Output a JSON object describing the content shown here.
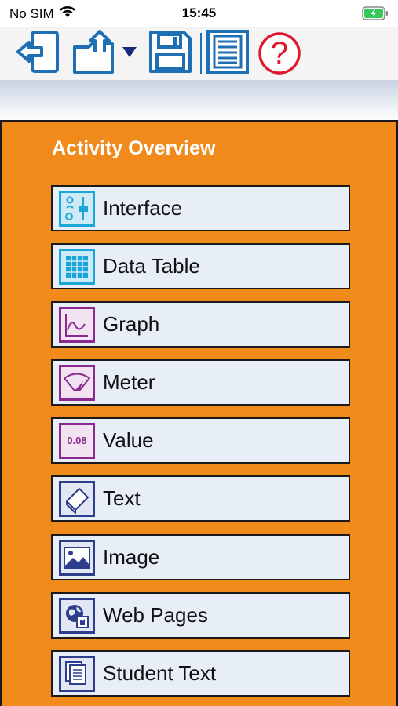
{
  "status": {
    "carrier": "No SIM",
    "time": "15:45"
  },
  "toolbar": {
    "icons": [
      "exit-icon",
      "export-icon",
      "dropdown-arrow-icon",
      "save-icon",
      "notes-icon",
      "help-icon"
    ],
    "help_glyph": "?"
  },
  "panel": {
    "title": "Activity Overview",
    "items": [
      {
        "label": "Interface",
        "icon": "interface-icon"
      },
      {
        "label": "Data Table",
        "icon": "data-table-icon"
      },
      {
        "label": "Graph",
        "icon": "graph-icon"
      },
      {
        "label": "Meter",
        "icon": "meter-icon"
      },
      {
        "label": "Value",
        "icon": "value-icon",
        "icon_text": "0.08"
      },
      {
        "label": "Text",
        "icon": "text-icon"
      },
      {
        "label": "Image",
        "icon": "image-icon"
      },
      {
        "label": "Web Pages",
        "icon": "web-pages-icon"
      },
      {
        "label": "Student Text",
        "icon": "student-text-icon"
      }
    ]
  },
  "colors": {
    "panel_orange": "#f08a1a",
    "toolbar_blue": "#1f6fb5",
    "help_red": "#e0182d",
    "item_bg": "#e7eef7",
    "icon_cyan": "#1aa7d8",
    "icon_purple": "#8a2a8f",
    "icon_navy": "#2c3e8c"
  }
}
